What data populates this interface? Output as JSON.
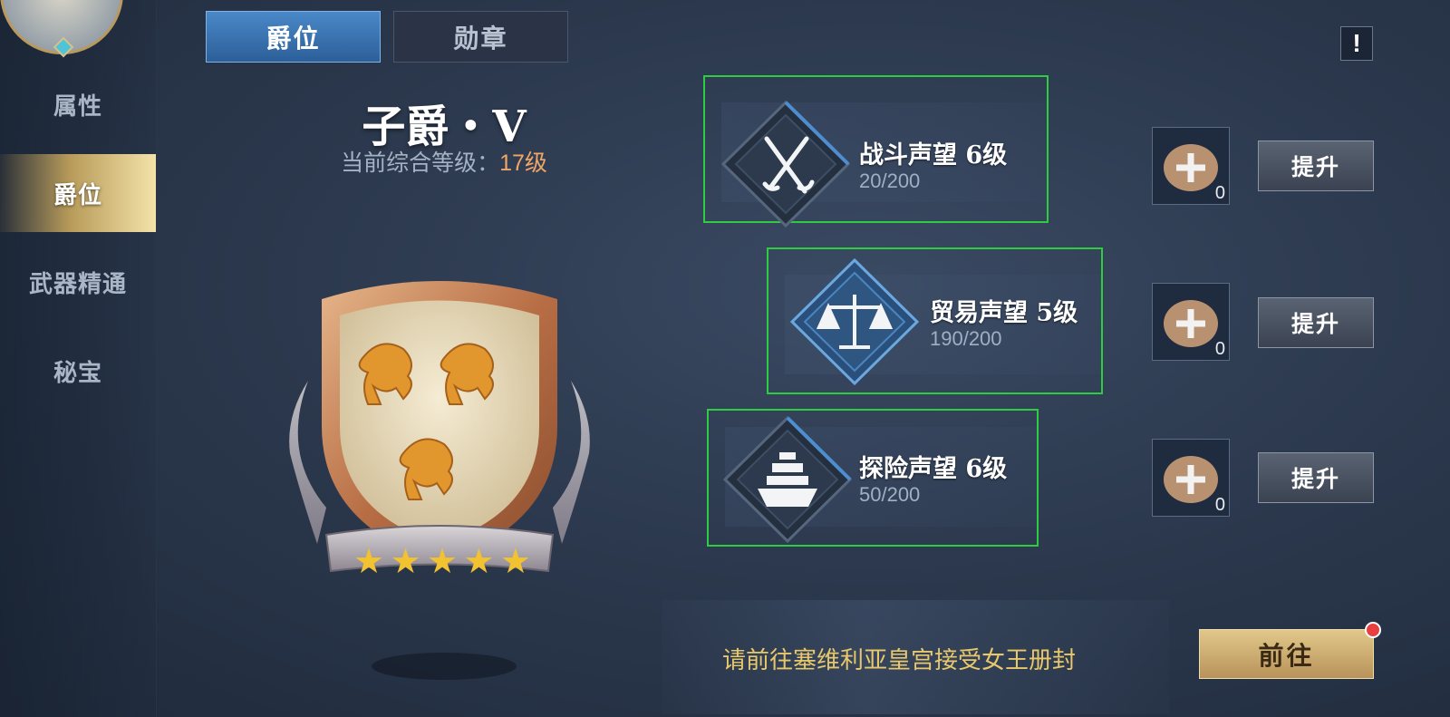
{
  "sidebar": {
    "items": [
      {
        "label": "属性",
        "active": false
      },
      {
        "label": "爵位",
        "active": true
      },
      {
        "label": "武器精通",
        "active": false
      },
      {
        "label": "秘宝",
        "active": false
      }
    ]
  },
  "tabs": [
    {
      "label": "爵位",
      "active": true
    },
    {
      "label": "勋章",
      "active": false
    }
  ],
  "info_button": "!",
  "rank": {
    "title": "子爵・V",
    "level_label": "当前综合等级：",
    "level_value": "17级",
    "stars": 5
  },
  "reputations": [
    {
      "name": "战斗声望 6级",
      "progress": "20/200",
      "icon": "swords-icon",
      "item_count": "0",
      "button": "提升"
    },
    {
      "name": "贸易声望 5级",
      "progress": "190/200",
      "icon": "scales-icon",
      "item_count": "0",
      "button": "提升"
    },
    {
      "name": "探险声望 6级",
      "progress": "50/200",
      "icon": "ship-icon",
      "item_count": "0",
      "button": "提升"
    }
  ],
  "quest": {
    "text": "请前往塞维利亚皇宫接受女王册封",
    "button": "前往",
    "notification": true
  },
  "colors": {
    "accent_gold": "#e8c86a",
    "level_orange": "#f0a667",
    "tab_blue": "#3a74b4",
    "highlight_green": "#2ecc40"
  }
}
